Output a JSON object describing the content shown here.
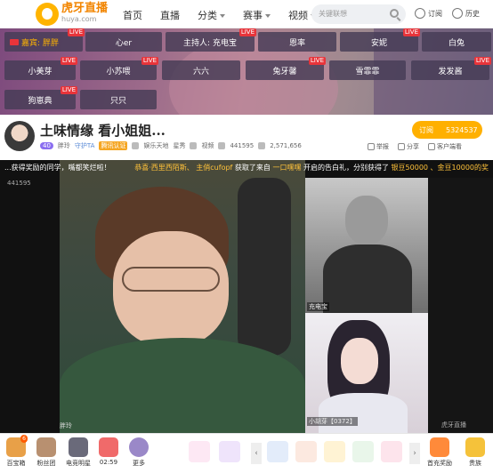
{
  "nav": {
    "logo_cn": "虎牙直播",
    "logo_url": "huya.com",
    "links": [
      "首页",
      "直播",
      "分类",
      "赛事",
      "视频"
    ],
    "search_placeholder": "关键联想",
    "subscribe": "订阅",
    "history": "历史"
  },
  "banner": {
    "guest_prefix": "嘉宾:",
    "guest_name": "胖胖",
    "live_badge": "LIVE",
    "row1": [
      "心er",
      "主持人: 充电宝",
      "恩率",
      "安妮",
      "白兔"
    ],
    "row2": [
      "小美芽",
      "小苏喂",
      "六六",
      "兔牙馨",
      "雪霏霏",
      "发发酱"
    ],
    "row3": [
      "狗崽典",
      "只只"
    ]
  },
  "room": {
    "title": "土味情缘 看小姐姐...",
    "level": "40",
    "host": "胖玲",
    "guard": "守护TA",
    "cert": "腾讯认证",
    "category": "娱乐天地",
    "subcat": "星秀",
    "video_label": "视频",
    "viewers": "441595",
    "fans": "2,571,656",
    "subscribe_label": "订阅",
    "subscribe_count": "5324537",
    "report": "举报",
    "share": "分享",
    "client": "客户端看"
  },
  "video": {
    "ticker_a": "...获得奖励的同学，嘴都笑烂啦！",
    "ticker_b": "恭喜·西里西陌斯、",
    "ticker_c": "主俏cufopf",
    "ticker_d": "获取了来自",
    "ticker_e": "一口嘿嘿",
    "ticker_f": "开启的告白礼，分别获得了",
    "ticker_g": "银豆50000",
    "ticker_h": "、金豆10000的奖",
    "main_caption": "胖玲",
    "pipA_caption": "充电宝",
    "pipB_caption": "小胡芽【0372】",
    "watermark": "虎牙直播",
    "corner_id": "441595"
  },
  "bottom": {
    "items": [
      "百宝箱",
      "粉丝团",
      "电竞明星",
      "02:59",
      "更多"
    ],
    "treasure_badge": "6",
    "right_items": [
      "首充奖励",
      "贵族"
    ]
  }
}
